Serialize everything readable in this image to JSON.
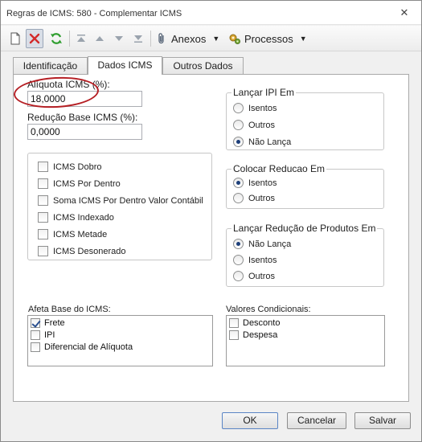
{
  "window": {
    "title": "Regras de ICMS: 580 - Complementar ICMS",
    "close_glyph": "✕"
  },
  "toolbar": {
    "new_icon": "new-document-icon",
    "delete_icon": "delete-icon",
    "refresh_icon": "refresh-icon",
    "anexos_label": "Anexos",
    "processos_label": "Processos",
    "dropdown_glyph": "▼",
    "delete_color": "#d32a2a",
    "refresh_color": "#2f9e2f"
  },
  "tabs": [
    {
      "label": "Identificação"
    },
    {
      "label": "Dados ICMS"
    },
    {
      "label": "Outros Dados"
    }
  ],
  "fields": {
    "aliquota_label": "Alíquota ICMS (%):",
    "aliquota_value": "18,0000",
    "reducao_label": "Redução Base ICMS (%):",
    "reducao_value": "0,0000"
  },
  "icms_options": [
    {
      "label": "ICMS Dobro",
      "checked": false
    },
    {
      "label": "ICMS Por Dentro",
      "checked": false
    },
    {
      "label": "Soma ICMS Por Dentro Valor Contábil",
      "checked": false
    },
    {
      "label": "ICMS Indexado",
      "checked": false
    },
    {
      "label": "ICMS Metade",
      "checked": false
    },
    {
      "label": "ICMS Desonerado",
      "checked": false
    }
  ],
  "lancar_ipi": {
    "title": "Lançar IPI Em",
    "options": [
      {
        "label": "Isentos",
        "checked": false
      },
      {
        "label": "Outros",
        "checked": false
      },
      {
        "label": "Não Lança",
        "checked": true
      }
    ]
  },
  "colocar_reducao": {
    "title": "Colocar Reducao Em",
    "options": [
      {
        "label": "Isentos",
        "checked": true
      },
      {
        "label": "Outros",
        "checked": false
      }
    ]
  },
  "lancar_reducao_produtos": {
    "title": "Lançar Redução de Produtos Em",
    "options": [
      {
        "label": "Não Lança",
        "checked": true
      },
      {
        "label": "Isentos",
        "checked": false
      },
      {
        "label": "Outros",
        "checked": false
      }
    ]
  },
  "afeta_base": {
    "title": "Afeta Base do ICMS:",
    "items": [
      {
        "label": "Frete",
        "checked": true
      },
      {
        "label": "IPI",
        "checked": false
      },
      {
        "label": "Diferencial de Alíquota",
        "checked": false
      }
    ]
  },
  "valores_condicionais": {
    "title": "Valores Condicionais:",
    "items": [
      {
        "label": "Desconto",
        "checked": false
      },
      {
        "label": "Despesa",
        "checked": false
      }
    ]
  },
  "buttons": {
    "ok": "OK",
    "cancel": "Cancelar",
    "save": "Salvar"
  },
  "annotation_color": "#b51f24"
}
